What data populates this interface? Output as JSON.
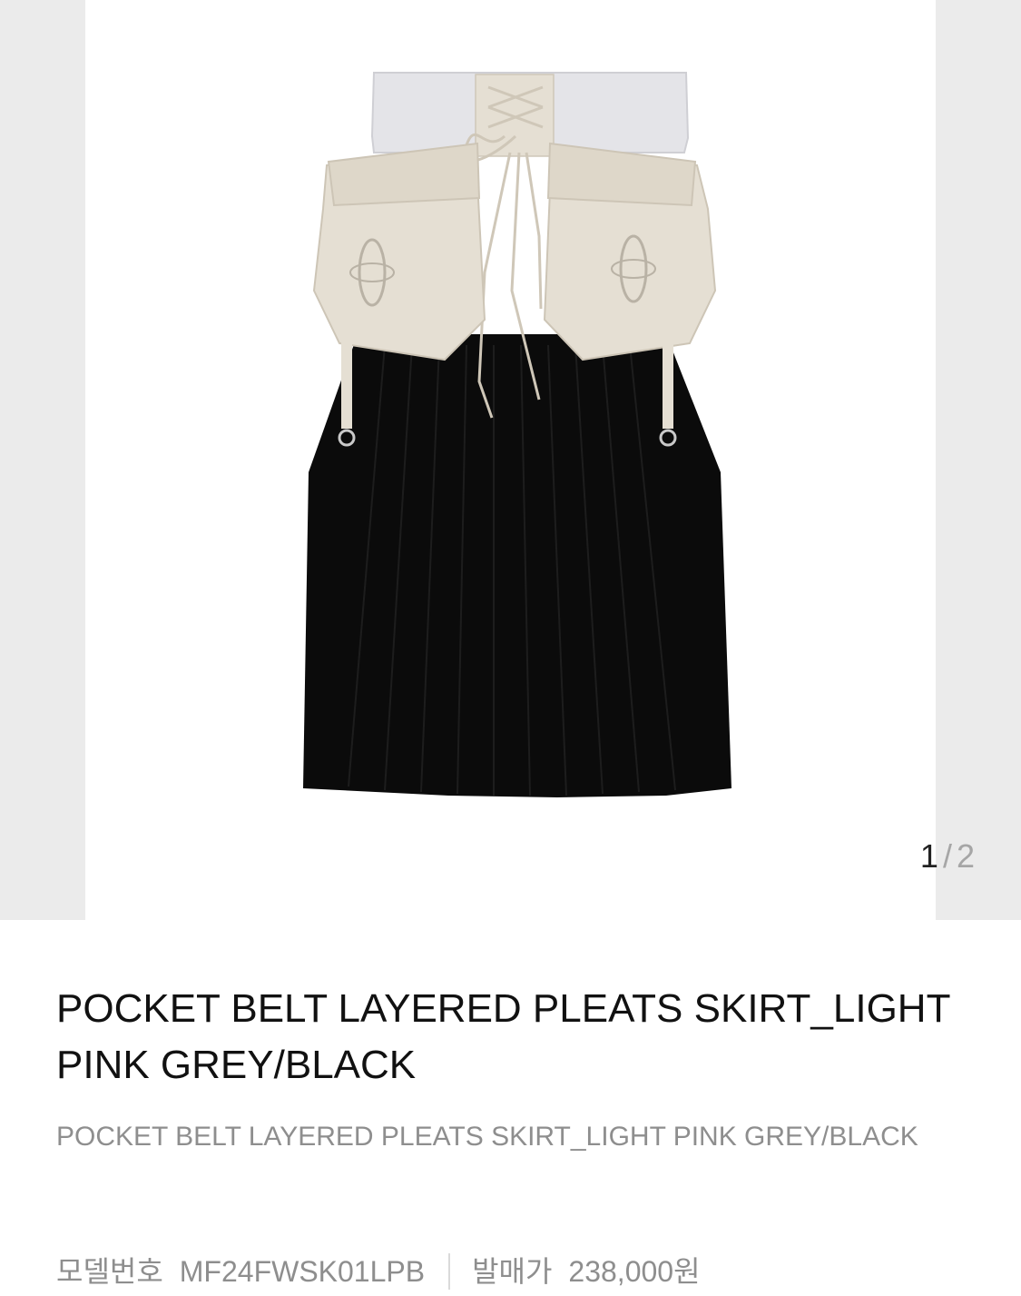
{
  "gallery": {
    "current_page": "1",
    "separator": "/",
    "total_pages": "2",
    "image_alt": "POCKET BELT LAYERED PLEATS SKIRT_LIGHT PINK GREY/BLACK"
  },
  "product": {
    "title": "POCKET BELT LAYERED PLEATS SKIRT_LIGHT PINK GREY/BLACK",
    "subtitle": "POCKET BELT LAYERED PLEATS SKIRT_LIGHT PINK GREY/BLACK",
    "model_label": "모델번호",
    "model_number": "MF24FWSK01LPB",
    "release_price_label": "발매가",
    "release_price": "238,000원"
  },
  "colors": {
    "skirt_black": "#0b0b0b",
    "waistband_grey": "#e4e4e8",
    "pocket_beige": "#e5dfd3",
    "pager_inactive": "#a6a6a6",
    "muted_text": "#8e8e8e"
  }
}
